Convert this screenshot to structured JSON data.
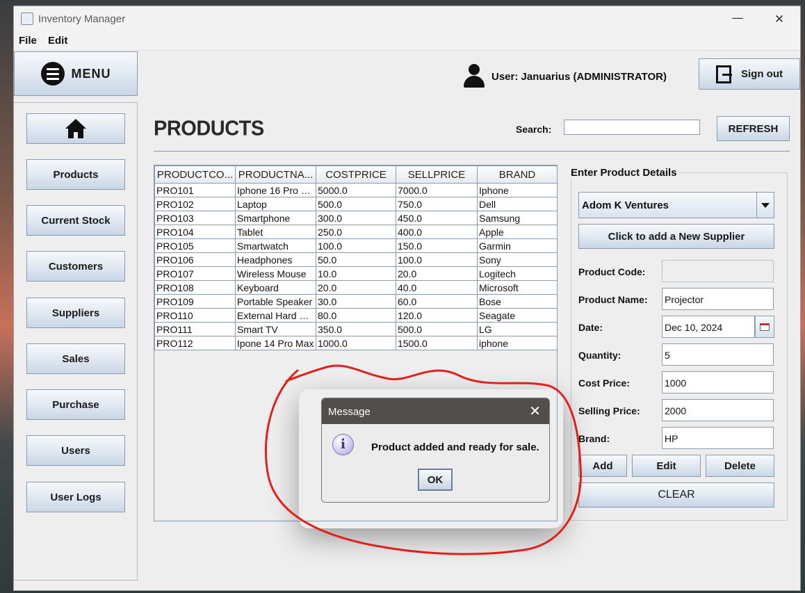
{
  "window": {
    "title": "Inventory Manager",
    "controls": {
      "minimize": "—",
      "maximize": "☐",
      "close": "✕"
    }
  },
  "menubar": {
    "items": [
      "File",
      "Edit"
    ]
  },
  "sidebar": {
    "menu_label": "MENU",
    "home_icon": "home-icon",
    "items": [
      "Products",
      "Current Stock",
      "Customers",
      "Suppliers",
      "Sales",
      "Purchase",
      "Users",
      "User Logs"
    ]
  },
  "header": {
    "user_text": "User: Januarius (ADMINISTRATOR)",
    "signout_label": "Sign out"
  },
  "main": {
    "page_title": "PRODUCTS",
    "search_label": "Search:",
    "search_value": "",
    "refresh_label": "REFRESH"
  },
  "table": {
    "columns": [
      "PRODUCTCO...",
      "PRODUCTNA...",
      "COSTPRICE",
      "SELLPRICE",
      "BRAND"
    ],
    "rows": [
      [
        "PRO101",
        "Iphone 16 Pro M...",
        "5000.0",
        "7000.0",
        "Iphone"
      ],
      [
        "PRO102",
        "Laptop",
        "500.0",
        "750.0",
        "Dell"
      ],
      [
        "PRO103",
        "Smartphone",
        "300.0",
        "450.0",
        "Samsung"
      ],
      [
        "PRO104",
        "Tablet",
        "250.0",
        "400.0",
        "Apple"
      ],
      [
        "PRO105",
        "Smartwatch",
        "100.0",
        "150.0",
        "Garmin"
      ],
      [
        "PRO106",
        "Headphones",
        "50.0",
        "100.0",
        "Sony"
      ],
      [
        "PRO107",
        "Wireless Mouse",
        "10.0",
        "20.0",
        "Logitech"
      ],
      [
        "PRO108",
        "Keyboard",
        "20.0",
        "40.0",
        "Microsoft"
      ],
      [
        "PRO109",
        "Portable Speaker",
        "30.0",
        "60.0",
        "Bose"
      ],
      [
        "PRO110",
        "External Hard D...",
        "80.0",
        "120.0",
        "Seagate"
      ],
      [
        "PRO111",
        "Smart TV",
        "350.0",
        "500.0",
        "LG"
      ],
      [
        "PRO112",
        "Ipone 14 Pro Max",
        "1000.0",
        "1500.0",
        "iphone"
      ]
    ]
  },
  "details": {
    "title": "Enter Product Details",
    "supplier_value": "Adom K Ventures",
    "add_supplier_label": "Click to add a New Supplier",
    "fields": {
      "code": {
        "label": "Product Code:",
        "value": ""
      },
      "name": {
        "label": "Product Name:",
        "value": "Projector"
      },
      "date": {
        "label": "Date:",
        "value": "Dec 10, 2024"
      },
      "quantity": {
        "label": "Quantity:",
        "value": "5"
      },
      "cost": {
        "label": "Cost Price:",
        "value": "1000"
      },
      "selling": {
        "label": "Selling Price:",
        "value": "2000"
      },
      "brand": {
        "label": "Brand:",
        "value": "HP"
      }
    },
    "buttons": {
      "add": "Add",
      "edit": "Edit",
      "delete": "Delete",
      "clear": "CLEAR"
    }
  },
  "dialog": {
    "title": "Message",
    "close": "✕",
    "message": "Product added and ready for sale.",
    "ok": "OK",
    "icon": "info-icon",
    "icon_glyph": "i"
  },
  "annotation": {
    "color": "#e0201b"
  }
}
